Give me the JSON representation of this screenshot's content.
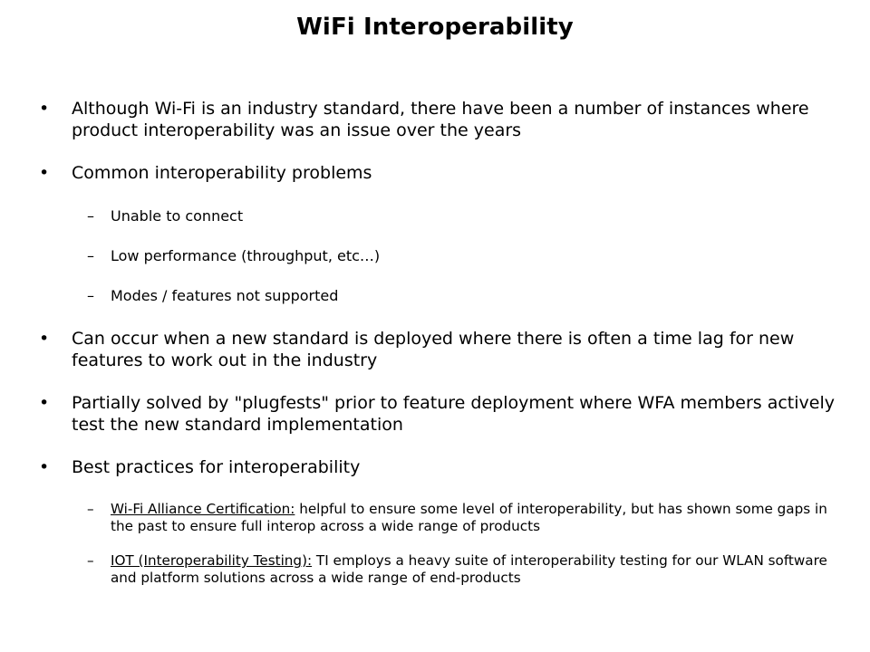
{
  "slide": {
    "title": "WiFi Interoperability",
    "background_color": "#ffffff",
    "text_color": "#000000",
    "bullet_marker_level1": "•",
    "bullet_marker_level2": "–",
    "content": [
      {
        "level": 1,
        "text": "Although Wi-Fi is an industry standard, there have been a number of instances where product interoperability was an issue over the years"
      },
      {
        "level": 1,
        "text": "Common interoperability problems"
      },
      {
        "level": 2,
        "text": "Unable to connect"
      },
      {
        "level": 2,
        "text": "Low performance (throughput, etc…)"
      },
      {
        "level": 2,
        "text": "Modes / features not supported"
      },
      {
        "level": 1,
        "text": "Can occur when a new standard is deployed where there is often a time lag for new features to work out in the industry"
      },
      {
        "level": 1,
        "text": "Partially solved by \"plugfests\" prior to feature deployment where WFA members actively test the new standard implementation"
      },
      {
        "level": 1,
        "text": "Best practices for interoperability"
      },
      {
        "level": 2,
        "compact": true,
        "lead_underlined": "Wi-Fi Alliance Certification:",
        "text": " helpful to ensure some level of interoperability, but has shown some gaps in the past to ensure full interop across a wide range of products"
      },
      {
        "level": 2,
        "compact": true,
        "lead_underlined": "IOT (Interoperability Testing):",
        "text": " TI employs a heavy suite of interoperability testing for our WLAN software and platform solutions across a wide range of end-products"
      }
    ]
  }
}
